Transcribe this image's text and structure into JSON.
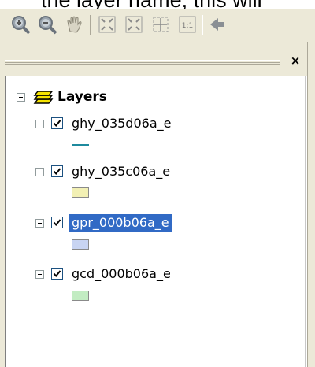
{
  "caption": {
    "text": "the layer name, this will"
  },
  "toolbar": {
    "buttons": [
      {
        "name": "zoom-in-tool",
        "icon": "magnifier-plus-icon"
      },
      {
        "name": "zoom-out-tool",
        "icon": "magnifier-minus-icon"
      },
      {
        "name": "pan-tool",
        "icon": "hand-icon"
      },
      {
        "name": "fixed-zoom-in-tool",
        "icon": "fixed-zoom-in-icon"
      },
      {
        "name": "fixed-zoom-out-tool",
        "icon": "fixed-zoom-out-icon"
      },
      {
        "name": "full-extent-tool",
        "icon": "full-extent-icon"
      },
      {
        "name": "zoom-to-scale-tool",
        "icon": "one-to-one-icon",
        "text": "1:1"
      },
      {
        "name": "previous-extent-tool",
        "icon": "back-arrow-icon"
      }
    ]
  },
  "panel": {
    "close_label": "×"
  },
  "toc": {
    "root_label": "Layers",
    "layers": [
      {
        "name": "ghy_035d06a_e",
        "checked": true,
        "selected": false,
        "symbol": "line",
        "color": "#1e8a9e"
      },
      {
        "name": "ghy_035c06a_e",
        "checked": true,
        "selected": false,
        "symbol": "fill",
        "color": "#f2f0b4"
      },
      {
        "name": "gpr_000b06a_e",
        "checked": true,
        "selected": true,
        "symbol": "fill",
        "color": "#c8d4f2"
      },
      {
        "name": "gcd_000b06a_e",
        "checked": true,
        "selected": false,
        "symbol": "fill",
        "color": "#c2ecc2"
      }
    ]
  }
}
